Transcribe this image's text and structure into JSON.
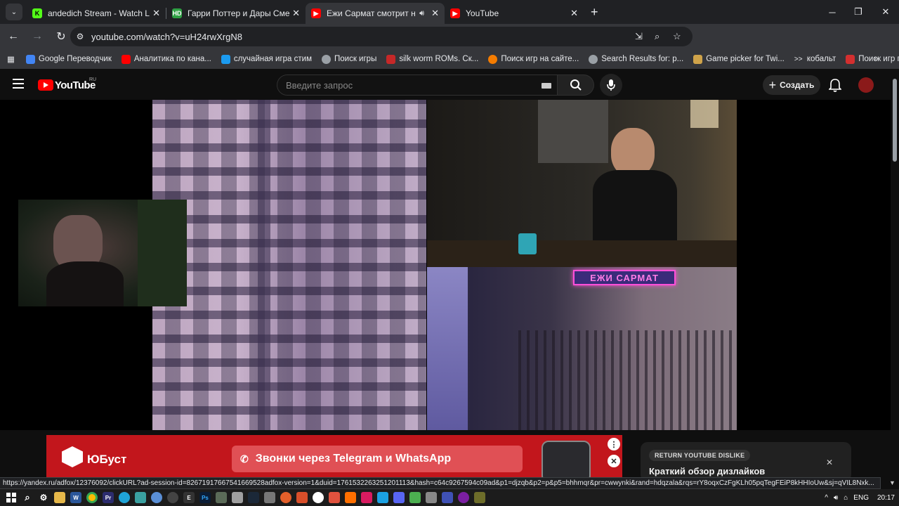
{
  "tabs": [
    {
      "title": "andedich Stream - Watch Live o",
      "favicon": "kick-icon",
      "color": "#53fc18",
      "active": false
    },
    {
      "title": "Гарри Поттер и Дары Смерти:",
      "favicon": "hd-icon",
      "color": "#2ea043",
      "active": false
    },
    {
      "title": "Ежи Сармат смотрит на Ст",
      "favicon": "youtube-icon",
      "color": "#ff0000",
      "active": true,
      "audio": true
    },
    {
      "title": "YouTube",
      "favicon": "youtube-icon",
      "color": "#ff0000",
      "active": false
    }
  ],
  "toolbar": {
    "url": "youtube.com/watch?v=uH24rwXrgN8"
  },
  "bookmarks": [
    {
      "label": "Google Переводчик",
      "color": "#4285f4"
    },
    {
      "label": "Аналитика по кана...",
      "color": "#ff0000"
    },
    {
      "label": "случайная игра стим",
      "color": "#1b9bf0"
    },
    {
      "label": "Поиск игры",
      "color": "#9aa0a6"
    },
    {
      "label": "silk worm ROMs. Ск...",
      "color": "#c62828"
    },
    {
      "label": "Поиск игр на сайте...",
      "color": "#f57c00"
    },
    {
      "label": "Search Results for: p...",
      "color": "#9aa0a6"
    },
    {
      "label": "Game picker for Twi...",
      "color": "#cfa34a"
    },
    {
      "label": "кобальт",
      "color": "#e8eaed"
    },
    {
      "label": "Поиск игр по филь...",
      "color": "#d32f2f"
    }
  ],
  "youtube": {
    "logo": "YouTube",
    "region": "RU",
    "search_placeholder": "Введите запрос",
    "create_label": "Создать"
  },
  "video": {
    "overlay_title": "ЕЖИ САРМАТ"
  },
  "ad": {
    "brand": "ЮБуст",
    "headline": "Звонки через Telegram и WhatsApp"
  },
  "ryd_card": {
    "badge": "RETURN YOUTUBE DISLIKE",
    "title": "Краткий обзор дизлайков"
  },
  "status_url": "https://yandex.ru/adfox/12376092/clickURL?ad-session-id=82671917667541669528adfox-version=1&duid=1761532263251201113&hash=c64c9267594c09ad&p1=djzqb&p2=p&p5=bhhmqr&pr=cwwynki&rand=hdqzala&rqs=rY8oqxCzFgKLh05pqTegFEiP8kHHIoUw&sj=qVIL8Nxk...",
  "taskbar": {
    "language": "ENG",
    "time": "20:17"
  }
}
